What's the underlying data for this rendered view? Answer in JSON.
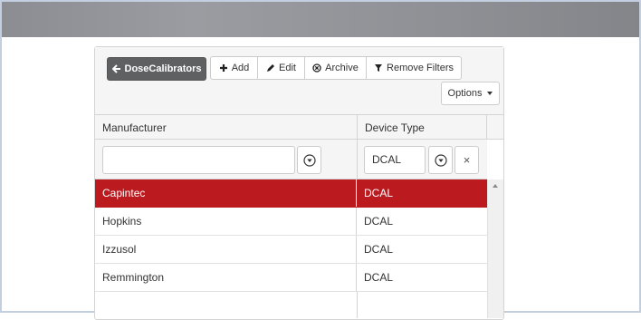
{
  "toolbar": {
    "back_label": "DoseCalibrators",
    "add_label": "Add",
    "edit_label": "Edit",
    "archive_label": "Archive",
    "remove_filters_label": "Remove Filters",
    "options_label": "Options"
  },
  "grid": {
    "columns": [
      "Manufacturer",
      "Device Type"
    ],
    "filters": {
      "manufacturer_value": "",
      "device_type_value": "DCAL",
      "clear_symbol": "×"
    },
    "rows": [
      {
        "manufacturer": "Capintec",
        "device_type": "DCAL",
        "selected": true
      },
      {
        "manufacturer": "Hopkins",
        "device_type": "DCAL",
        "selected": false
      },
      {
        "manufacturer": "Izzusol",
        "device_type": "DCAL",
        "selected": false
      },
      {
        "manufacturer": "Remmington",
        "device_type": "DCAL",
        "selected": false
      }
    ]
  },
  "colors": {
    "selected_row": "#bb1a1f",
    "back_button": "#5f6062",
    "top_bar": "#8e9095"
  },
  "icons": [
    "arrow-left-icon",
    "plus-icon",
    "pencil-icon",
    "circle-x-icon",
    "filter-icon",
    "caret-down-icon",
    "circle-chevron-down-icon",
    "close-icon",
    "scroll-up-icon"
  ]
}
